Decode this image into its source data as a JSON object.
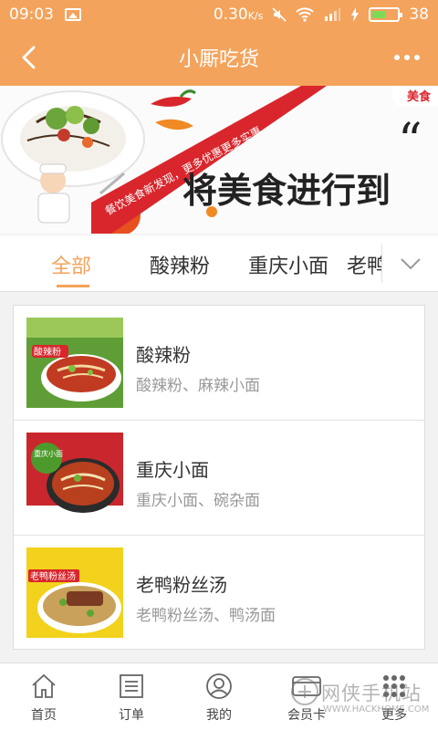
{
  "status_bar": {
    "time": "09:03",
    "network_speed": "0.30",
    "network_unit": "K/s",
    "battery": "38"
  },
  "header": {
    "title": "小厮吃货"
  },
  "banner": {
    "ribbon_text": "餐饮美食新发现，更多优惠更多实惠",
    "slogan": "将美食进行到",
    "corner_badge": "美食"
  },
  "tabs": [
    {
      "label": "全部"
    },
    {
      "label": "酸辣粉"
    },
    {
      "label": "重庆小面"
    },
    {
      "label": "老鸭粉丝汤"
    }
  ],
  "items": [
    {
      "name": "酸辣粉",
      "desc": "酸辣粉、麻辣小面",
      "thumb_label": "酸辣粉"
    },
    {
      "name": "重庆小面",
      "desc": "重庆小面、碗杂面",
      "thumb_label": "重庆小面"
    },
    {
      "name": "老鸭粉丝汤",
      "desc": "老鸭粉丝汤、鸭汤面",
      "thumb_label": "老鸭粉丝汤"
    }
  ],
  "bottom_nav": [
    {
      "label": "首页",
      "icon": "home-icon"
    },
    {
      "label": "订单",
      "icon": "order-list-icon"
    },
    {
      "label": "我的",
      "icon": "user-icon"
    },
    {
      "label": "会员卡",
      "icon": "card-icon"
    },
    {
      "label": "更多",
      "icon": "grid-icon"
    }
  ],
  "watermark": {
    "main": "网侠手机站",
    "sub": "WWW.HACKHOME.COM"
  },
  "colors": {
    "accent": "#f4a35c",
    "ribbon": "#d9262c"
  }
}
